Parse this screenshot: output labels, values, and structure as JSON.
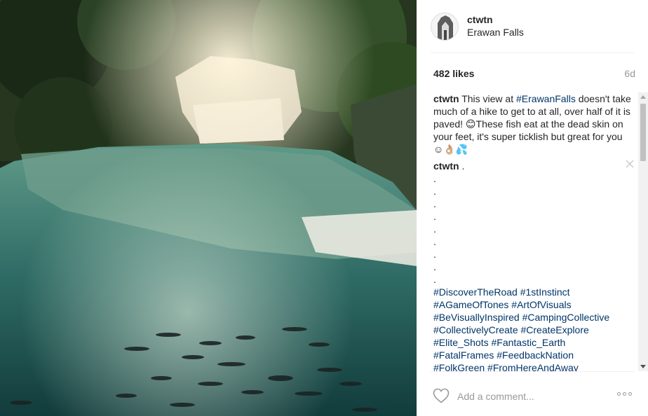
{
  "post": {
    "username": "ctwtn",
    "location": "Erawan Falls",
    "likes": "482 likes",
    "age": "6d"
  },
  "caption": {
    "user": "ctwtn",
    "text_before": " This view at ",
    "hashtag": "#ErawanFalls",
    "text_after": " doesn't take much of a hike to get to at all, over half of it is paved! 😊These fish eat at the dead skin on your feet, it's super ticklish but great for you ☺👌🏼💦"
  },
  "comment2": {
    "user": "ctwtn",
    "text": " ."
  },
  "dots": [
    ".",
    ".",
    ".",
    ".",
    ".",
    ".",
    ".",
    ".",
    "."
  ],
  "tag_lines": [
    [
      "#DiscoverTheRoad",
      "#1stInstinct"
    ],
    [
      "#AGameOfTones",
      "#ArtOfVisuals"
    ],
    [
      "#BeVisuallyInspired",
      "#CampingCollective"
    ],
    [
      "#CollectivelyCreate",
      "#CreateExplore"
    ],
    [
      "#Elite_Shots",
      "#Fantastic_Earth"
    ],
    [
      "#FatalFrames",
      "#FeedbackNation"
    ],
    [
      "#FolkGreen",
      "#FromHereAndAway"
    ]
  ],
  "footer": {
    "comment_placeholder": "Add a comment..."
  },
  "icons": {
    "like": "heart-outline-icon",
    "more": "more-options-icon",
    "close": "close-icon"
  },
  "colors": {
    "link": "#003569",
    "muted": "#999999",
    "text": "#262626"
  }
}
